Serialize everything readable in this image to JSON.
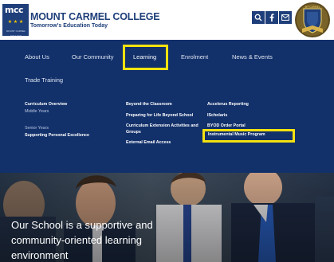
{
  "brand": {
    "logo_text": "mcc",
    "logo_small_text": "MOUNT CARMEL COLLEGE",
    "name": "MOUNT CARMEL COLLEGE",
    "tagline": "Tomorrow's Education Today",
    "primary_color": "#1f3f7a",
    "accent_color": "#f3e20f"
  },
  "header_icons": [
    "search-icon",
    "facebook-icon",
    "mail-icon"
  ],
  "crest_text": "MT CARMEL",
  "nav": {
    "items": [
      {
        "label": "About Us"
      },
      {
        "label": "Our Community"
      },
      {
        "label": "Learning",
        "active": true
      },
      {
        "label": "Enrolment"
      },
      {
        "label": "News & Events"
      },
      {
        "label": "Trade Training"
      }
    ]
  },
  "dropdown": {
    "col1": [
      "Curriculum Overview",
      "Middle Years",
      "Senior Years",
      "Supporting Personal Excellence"
    ],
    "col2": [
      "Beyond the Classroom",
      "Preparing for Life Beyond School",
      "Curriculum Extension Activities and",
      "Groups",
      "External Email Access"
    ],
    "col3": [
      "Accelerus Reporting",
      "IScholaris",
      "BYOD Order Portal",
      "Instrumental Music Program"
    ]
  },
  "hero": {
    "lines": [
      "Our School is a supportive and",
      "community-oriented learning",
      "environment"
    ]
  }
}
